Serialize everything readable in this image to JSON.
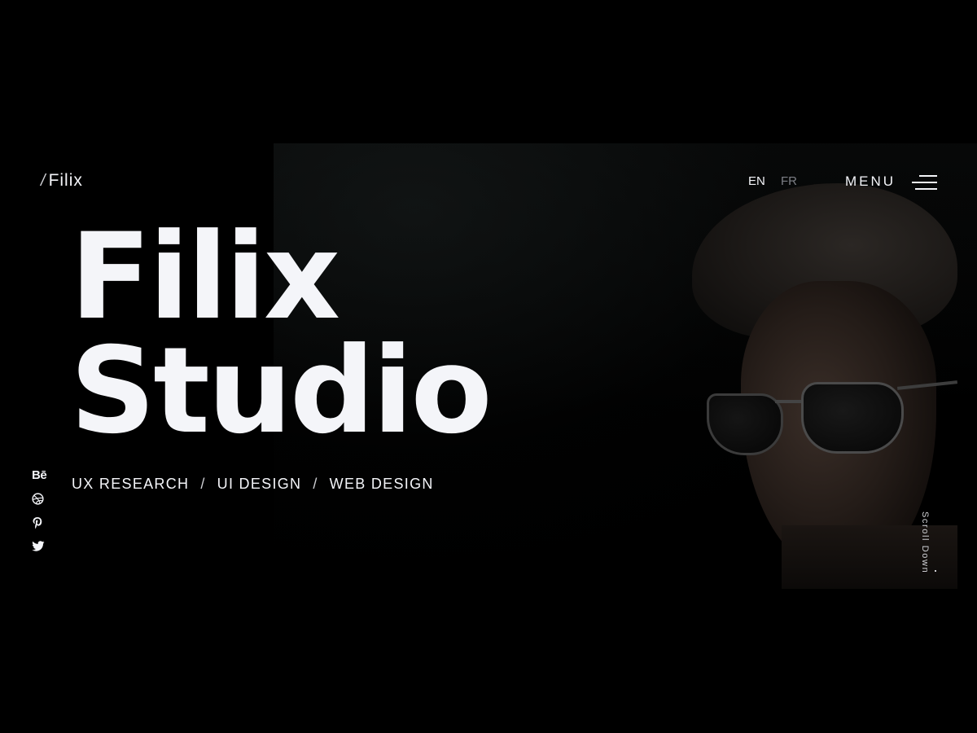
{
  "header": {
    "logo_slash": "/",
    "logo_text": "Filix",
    "languages": [
      {
        "label": "EN",
        "active": true
      },
      {
        "label": "FR",
        "active": false
      }
    ],
    "menu_label": "MENU",
    "menu_icon": "hamburger-menu-icon"
  },
  "hero": {
    "title_line1": "Filix",
    "title_line2": "Studio",
    "services": [
      "UX RESEARCH",
      "UI DESIGN",
      "WEB DESIGN"
    ],
    "separator": "/"
  },
  "social": [
    {
      "name": "behance",
      "icon": "behance-icon",
      "glyph": "Bē"
    },
    {
      "name": "dribbble",
      "icon": "dribbble-icon"
    },
    {
      "name": "pinterest",
      "icon": "pinterest-icon"
    },
    {
      "name": "twitter",
      "icon": "twitter-icon"
    }
  ],
  "scroll": {
    "label": "Scroll Down"
  },
  "colors": {
    "background": "#000000",
    "text": "#f4f5f9",
    "muted": "#7d7f86"
  }
}
